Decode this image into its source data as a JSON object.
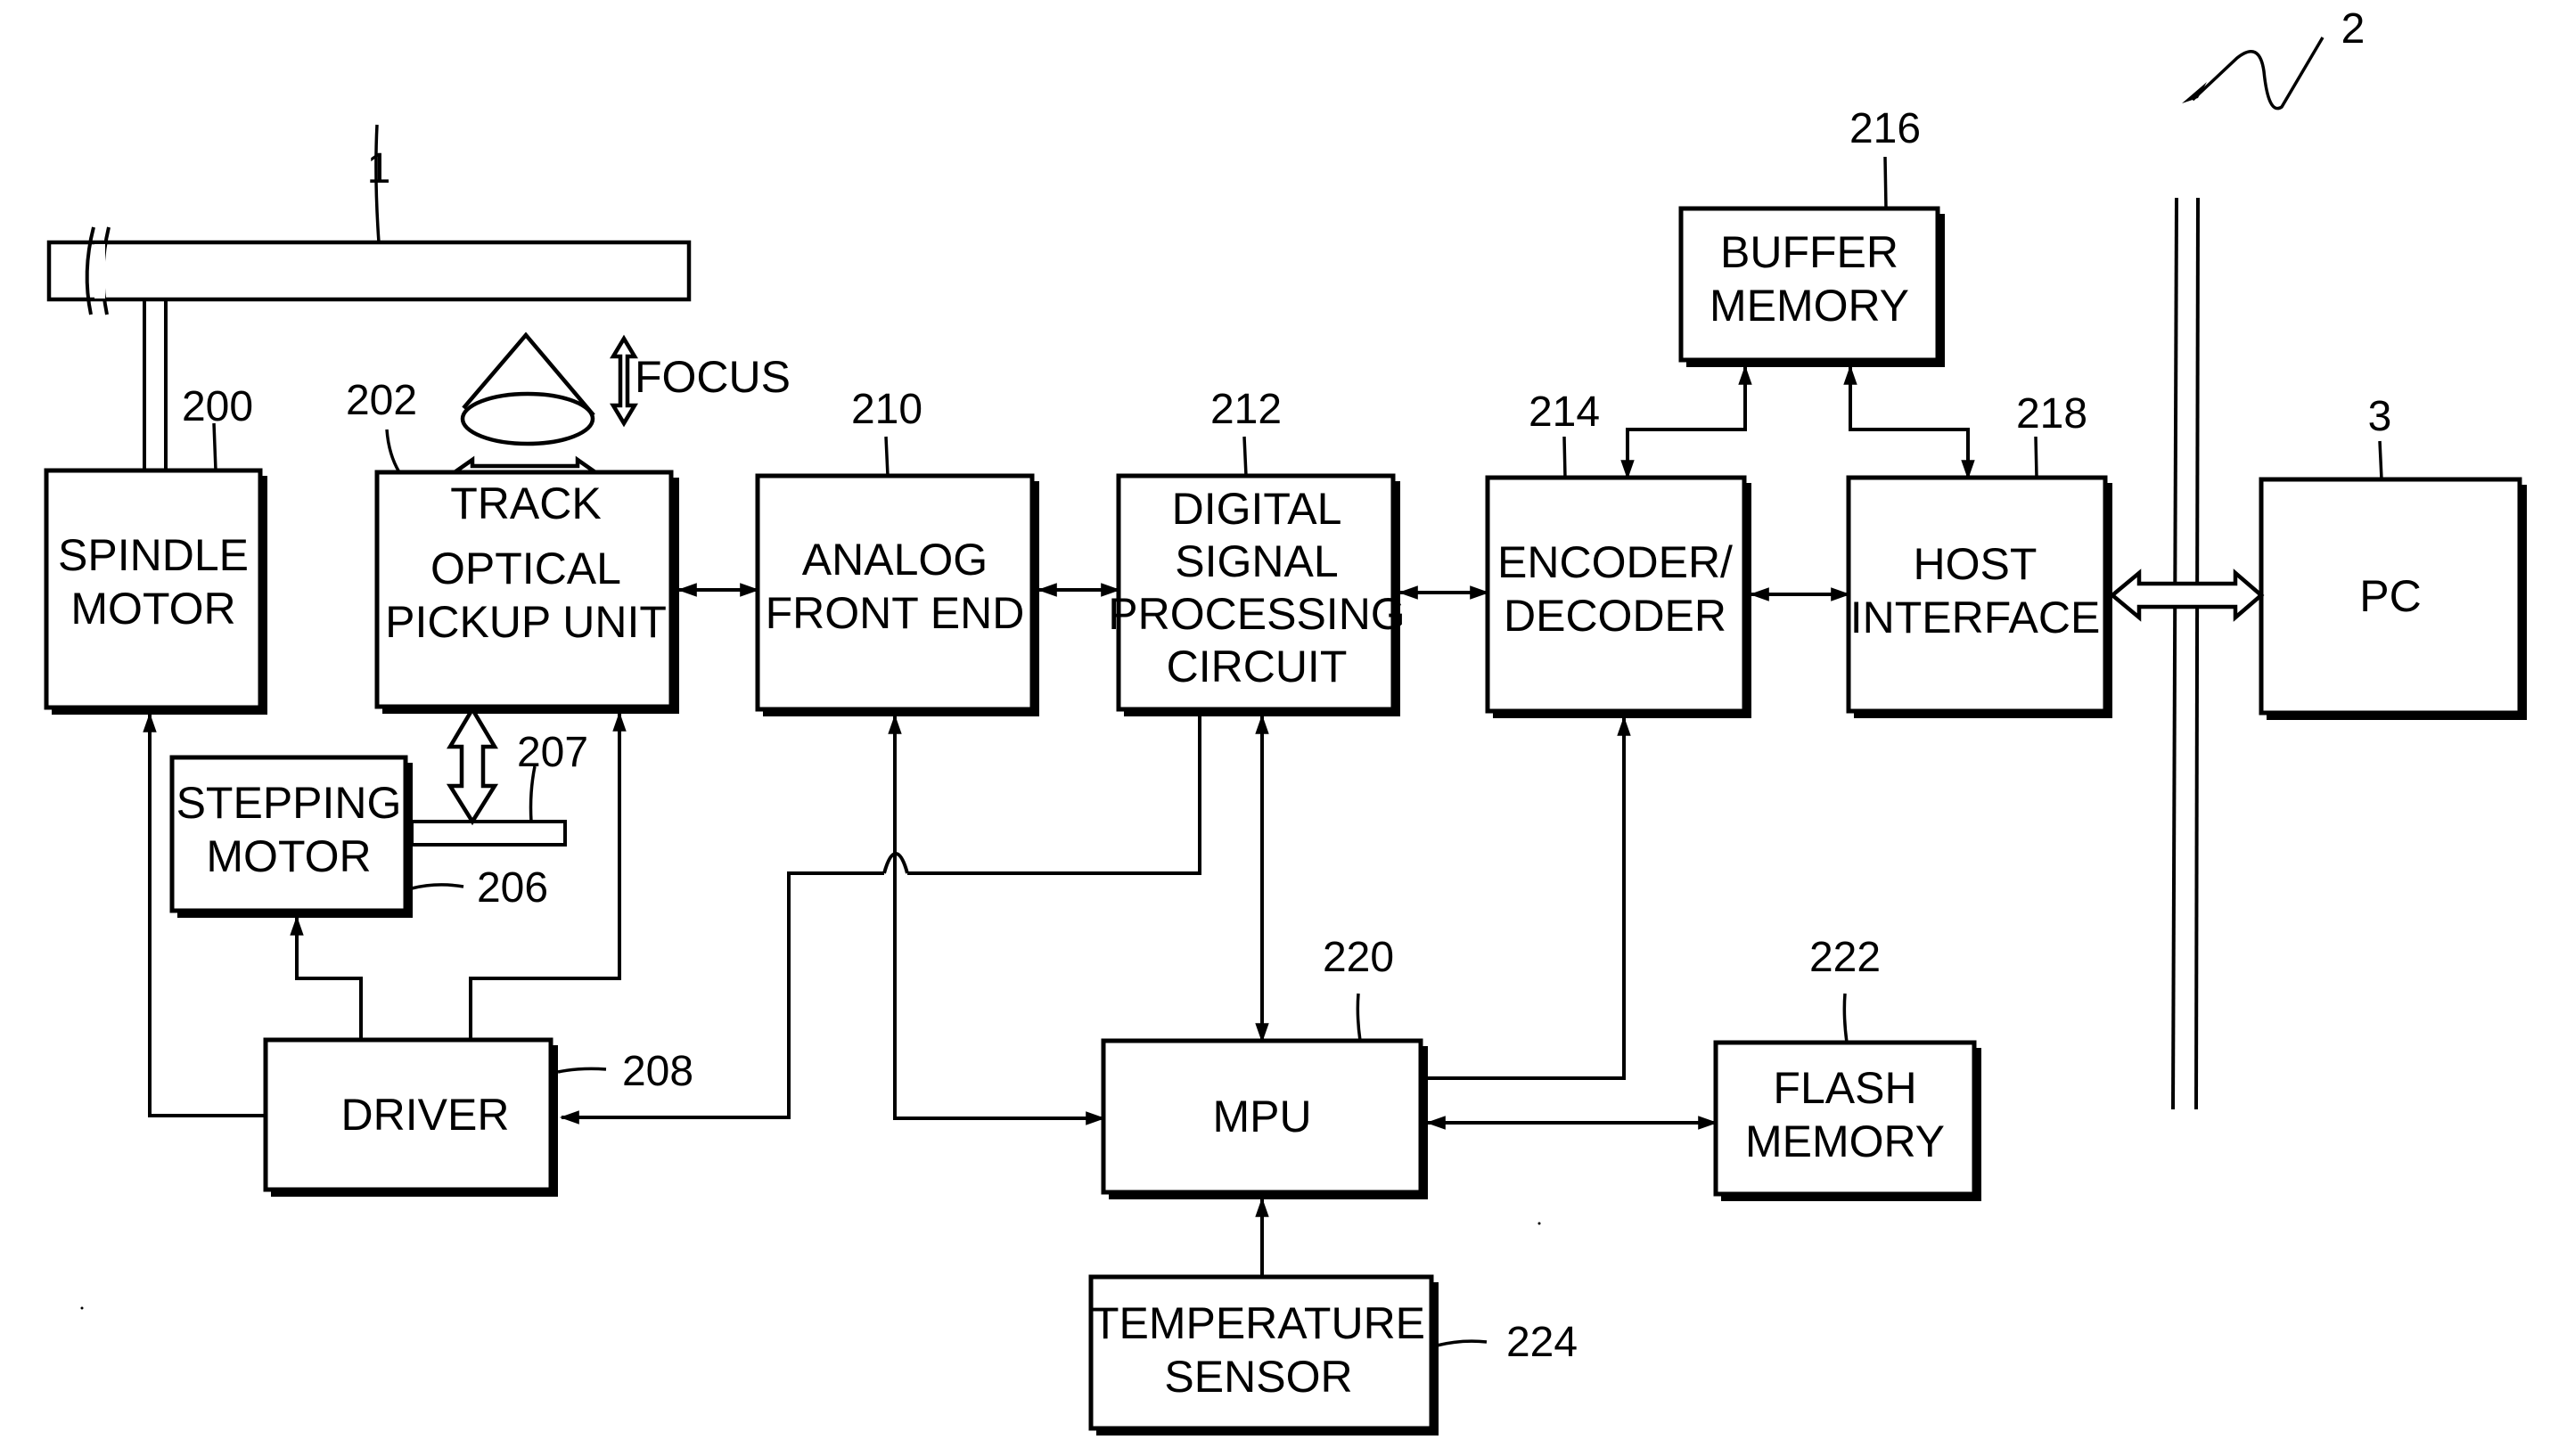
{
  "figure": {
    "ref_device": "2",
    "ref_disc": "1"
  },
  "blocks": {
    "spindle_motor": {
      "ref": "200",
      "lines": [
        "SPINDLE",
        "MOTOR"
      ]
    },
    "optical_pickup": {
      "ref": "202",
      "lines": [
        "OPTICAL",
        "PICKUP UNIT"
      ]
    },
    "analog_front_end": {
      "ref": "210",
      "lines": [
        "ANALOG",
        "FRONT END"
      ]
    },
    "dsp": {
      "ref": "212",
      "lines": [
        "DIGITAL",
        "SIGNAL",
        "PROCESSING",
        "CIRCUIT"
      ]
    },
    "encoder_decoder": {
      "ref": "214",
      "lines": [
        "ENCODER/",
        "DECODER"
      ]
    },
    "buffer_memory": {
      "ref": "216",
      "lines": [
        "BUFFER",
        "MEMORY"
      ]
    },
    "host_interface": {
      "ref": "218",
      "lines": [
        "HOST",
        "INTERFACE"
      ]
    },
    "pc": {
      "ref": "3",
      "lines": [
        "PC"
      ]
    },
    "stepping_motor": {
      "ref": "206",
      "lines": [
        "STEPPING",
        "MOTOR"
      ]
    },
    "driver": {
      "ref": "208",
      "lines": [
        "DRIVER"
      ]
    },
    "mpu": {
      "ref": "220",
      "lines": [
        "MPU"
      ]
    },
    "flash_memory": {
      "ref": "222",
      "lines": [
        "FLASH",
        "MEMORY"
      ]
    },
    "temperature_sensor": {
      "ref": "224",
      "lines": [
        "TEMPERATURE",
        "SENSOR"
      ]
    }
  },
  "annotations": {
    "focus": "FOCUS",
    "track": "TRACK",
    "sled_ref": "207"
  }
}
